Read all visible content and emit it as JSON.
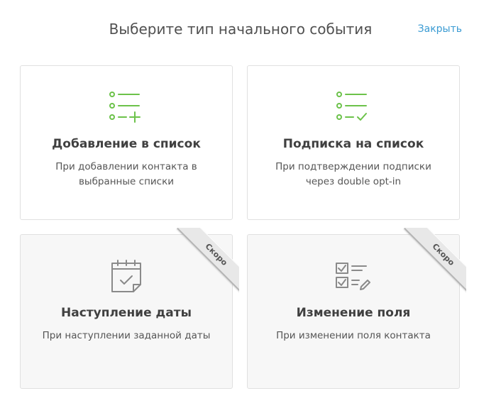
{
  "header": {
    "title": "Выберите тип начального события",
    "close_label": "Закрыть"
  },
  "colors": {
    "accent": "#3a9bd3",
    "icon_green": "#6cc24a",
    "icon_gray": "#8a8a8a"
  },
  "cards": [
    {
      "title": "Добавление в список",
      "description": "При добавлении контакта в выбранные списки",
      "icon": "list-add-icon",
      "enabled": true
    },
    {
      "title": "Подписка на список",
      "description": "При подтверждении подписки через double opt-in",
      "icon": "list-check-icon",
      "enabled": true
    },
    {
      "title": "Наступление даты",
      "description": "При наступлении заданной даты",
      "icon": "calendar-check-icon",
      "enabled": false,
      "badge": "Скоро"
    },
    {
      "title": "Изменение поля",
      "description": "При изменении поля контакта",
      "icon": "checklist-edit-icon",
      "enabled": false,
      "badge": "Скоро"
    }
  ]
}
